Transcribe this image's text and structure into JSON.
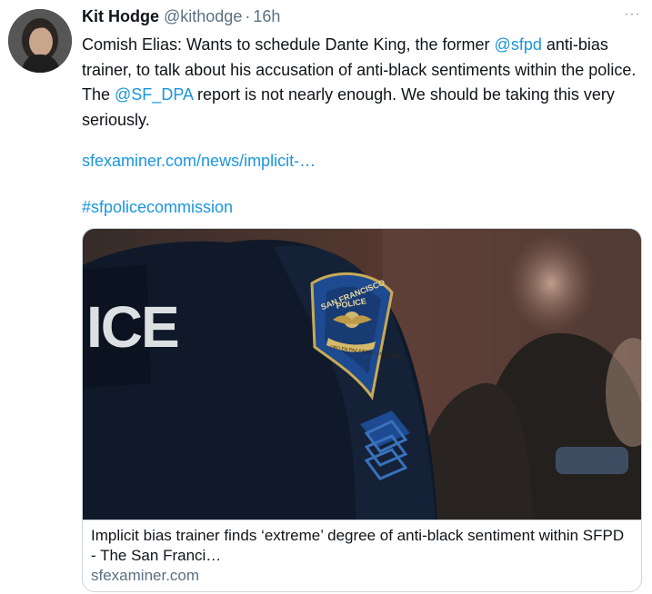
{
  "author": {
    "name": "Kit Hodge",
    "handle": "@kithodge",
    "separator": "·",
    "time": "16h"
  },
  "more_label": "···",
  "tweet": {
    "seg1": "Comish Elias: Wants to schedule Dante King, the former ",
    "mention1": "@sfpd",
    "seg2": " anti-bias trainer, to talk about his accusation of anti-black sentiments within the police. The ",
    "mention2": "@SF_DPA",
    "seg3": " report is not nearly enough. We should be taking this very seriously.",
    "link": "sfexaminer.com/news/implicit-…",
    "hashtag": "#sfpolicecommission"
  },
  "card": {
    "title": "Implicit bias trainer finds ‘extreme’ degree of anti-black sentiment within SFPD - The San Franci…",
    "domain": "sfexaminer.com",
    "image_text": {
      "back_lettering": "ICE",
      "patch_top": "SAN FRANCISCO",
      "patch_mid": "POLICE",
      "patch_ribbon": "ORO EN PAZ FIERRO EN GUERRA"
    }
  },
  "colors": {
    "link": "#1b95e0",
    "text": "#0f1419",
    "muted": "#5b7083",
    "border": "#ccd6dd"
  }
}
